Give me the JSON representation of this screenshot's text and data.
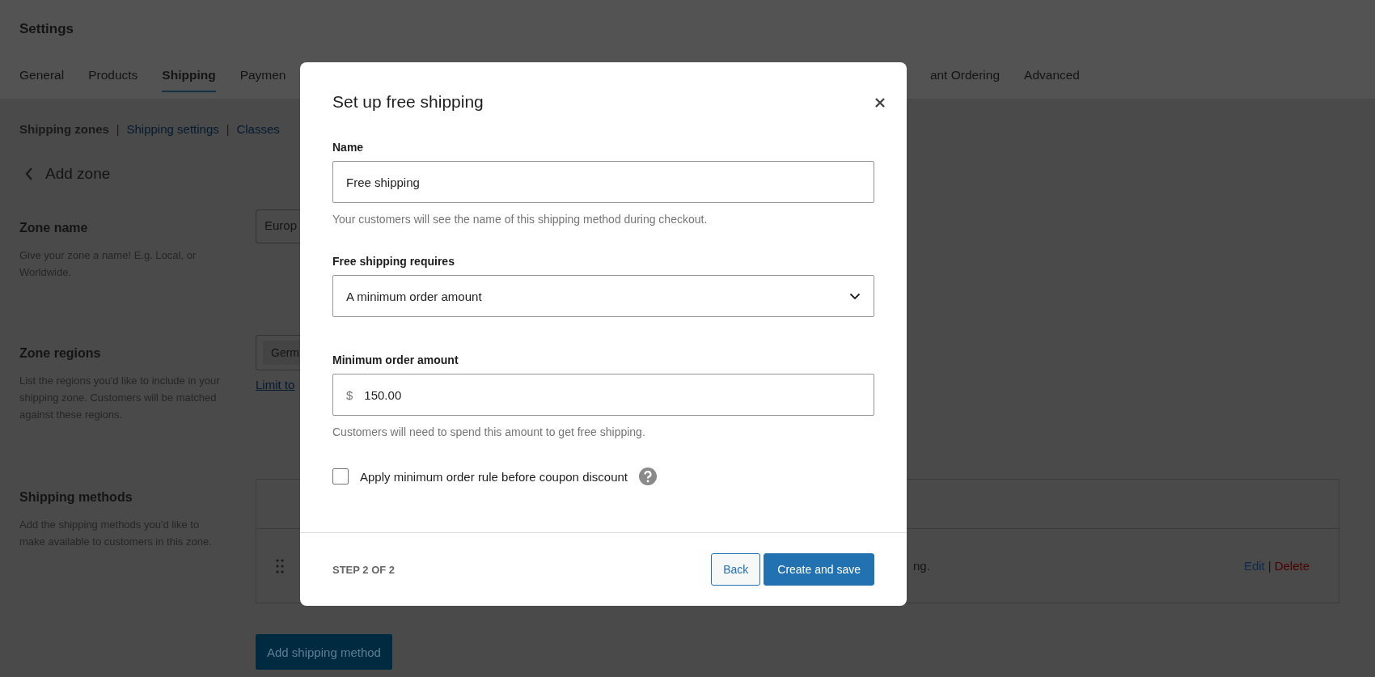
{
  "header": {
    "title": "Settings"
  },
  "tabs": [
    {
      "label": "General",
      "selected": false
    },
    {
      "label": "Products",
      "selected": false
    },
    {
      "label": "Shipping",
      "selected": true
    },
    {
      "label": "Paymen",
      "selected": false
    }
  ],
  "tabs_after_dialog": [
    {
      "label": "ant Ordering",
      "selected": false
    },
    {
      "label": "Advanced",
      "selected": false
    }
  ],
  "subnav": [
    {
      "label": "Shipping zones",
      "selected": true
    },
    {
      "separator": "|",
      "label": "Shipping settings",
      "selected": false
    },
    {
      "separator": "|",
      "label": "Classes",
      "selected": false
    }
  ],
  "back_link": "Add zone",
  "zone_name": {
    "title": "Zone name",
    "description": "Give your zone a name! E.g. Local, or Worldwide.",
    "value": "Europ"
  },
  "zone_regions": {
    "title": "Zone regions",
    "description": "List the regions you'd like to include in your shipping zone. Customers will be matched against these regions.",
    "chip": "Germ",
    "link": "Limit to"
  },
  "shipping_methods": {
    "title": "Shipping methods",
    "description": "Add the shipping methods you'd like to make available to customers in this zone.",
    "row": {
      "description": "ng.",
      "edit": "Edit",
      "separator": "|",
      "delete": "Delete"
    },
    "add_button": "Add shipping method"
  },
  "dialog": {
    "title": "Set up free shipping",
    "name": {
      "label": "Name",
      "value": "Free shipping",
      "help": "Your customers will see the name of this shipping method during checkout."
    },
    "requires": {
      "label": "Free shipping requires",
      "value": "A minimum order amount"
    },
    "minimum": {
      "label": "Minimum order amount",
      "currency": "$",
      "value": "150.00",
      "help": "Customers will need to spend this amount to get free shipping."
    },
    "coupon_rule": {
      "label": "Apply minimum order rule before coupon discount",
      "checked": false
    },
    "step": "STEP 2 OF 2",
    "back_button": "Back",
    "save_button": "Create and save"
  }
}
